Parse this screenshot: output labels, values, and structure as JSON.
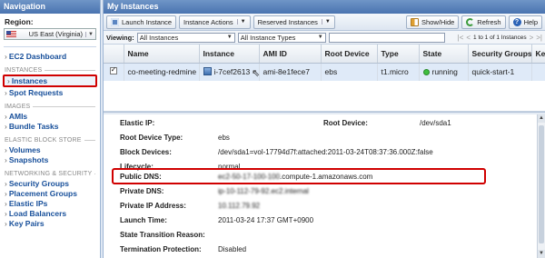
{
  "nav": {
    "header": "Navigation",
    "region_label": "Region:",
    "region_value": "US East (Virginia)",
    "ec2_dashboard": "EC2 Dashboard",
    "sections": {
      "instances": "INSTANCES",
      "images": "IMAGES",
      "ebs": "ELASTIC BLOCK STORE",
      "networking": "NETWORKING & SECURITY"
    },
    "items": {
      "instances": "Instances",
      "spot_requests": "Spot Requests",
      "amis": "AMIs",
      "bundle_tasks": "Bundle Tasks",
      "volumes": "Volumes",
      "snapshots": "Snapshots",
      "security_groups": "Security Groups",
      "placement_groups": "Placement Groups",
      "elastic_ips": "Elastic IPs",
      "load_balancers": "Load Balancers",
      "key_pairs": "Key Pairs"
    },
    "highlight_color": "#d00000"
  },
  "main": {
    "header": "My Instances",
    "toolbar": {
      "launch": "Launch Instance",
      "actions": "Instance Actions",
      "reserved": "Reserved Instances",
      "showhide": "Show/Hide",
      "refresh": "Refresh",
      "help": "Help"
    },
    "filter": {
      "viewing_label": "Viewing:",
      "instances_filter": "All Instances",
      "types_filter": "All Instance Types",
      "pager_text": "1 to 1 of 1 Instances"
    },
    "columns": [
      "Name",
      "Instance",
      "AMI ID",
      "Root Device",
      "Type",
      "State",
      "Security Groups",
      "Ke"
    ],
    "row": {
      "name": "co-meeting-redmine",
      "instance": "i-7cef2613",
      "ami": "ami-8e1fece7",
      "root_device": "ebs",
      "type": "t1.micro",
      "state": "running",
      "security_group": "quick-start-1"
    }
  },
  "details": {
    "elastic_ip_label": "Elastic IP:",
    "elastic_ip": "",
    "root_device_label": "Root Device:",
    "root_device": "/dev/sda1",
    "root_device_type_label": "Root Device Type:",
    "root_device_type": "ebs",
    "block_devices_label": "Block Devices:",
    "block_devices": "/dev/sda1=vol-17794d7f:attached:2011-03-24T08:37:36.000Z:false",
    "lifecycle_label": "Lifecycle:",
    "lifecycle": "normal",
    "public_dns_label": "Public DNS:",
    "public_dns_prefix": "ec2-50-17-100-100",
    "public_dns_suffix": ".compute-1.amazonaws.com",
    "private_dns_label": "Private DNS:",
    "private_dns": "ip-10-112-79-92.ec2.internal",
    "private_ip_label": "Private IP Address:",
    "private_ip": "10.112.79.92",
    "launch_time_label": "Launch Time:",
    "launch_time": "2011-03-24 17:37 GMT+0900",
    "transition_label": "State Transition Reason:",
    "transition": "",
    "termination_label": "Termination Protection:",
    "termination": "Disabled"
  }
}
